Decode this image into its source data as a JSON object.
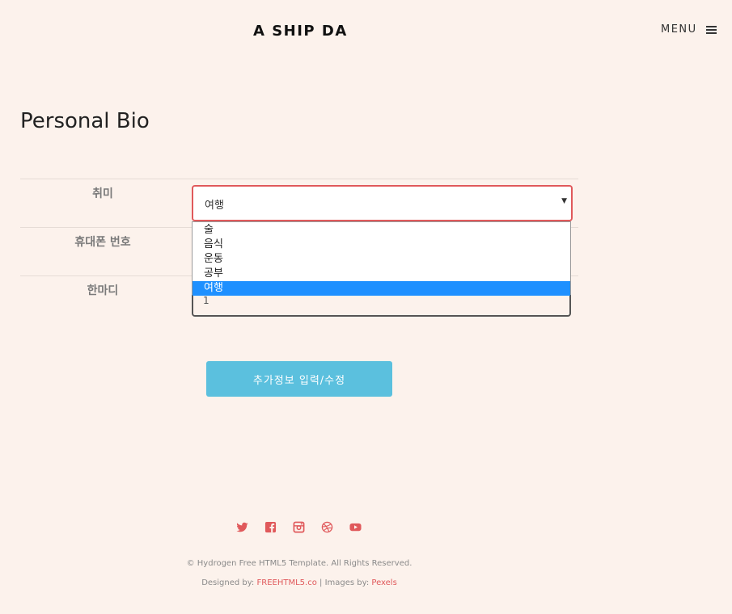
{
  "header": {
    "logo": "A SHIP DA",
    "menu_label": "MENU"
  },
  "page_title": "Personal Bio",
  "form": {
    "hobby_label": "취미",
    "hobby_selected": "여행",
    "phone_label": "휴대폰 번호",
    "comment_label": "한마디",
    "comment_value": "1",
    "hobby_options": [
      "술",
      "음식",
      "운동",
      "공부",
      "여행"
    ],
    "submit_label": "추가정보 입력/수정"
  },
  "social_icons": [
    "twitter-icon",
    "facebook-icon",
    "instagram-icon",
    "dribbble-icon",
    "youtube-icon"
  ],
  "footer": {
    "copyright": "© Hydrogen Free HTML5 Template. All Rights Reserved.",
    "designed_by": "Designed by:",
    "designer_link": "FREEHTML5.co",
    "separator": "|",
    "images_by": "Images by:",
    "images_link": "Pexels"
  },
  "colors": {
    "background": "#fcf2ec",
    "accent": "#e0595b",
    "button": "#5bc0de",
    "option_highlight": "#1e90ff"
  }
}
